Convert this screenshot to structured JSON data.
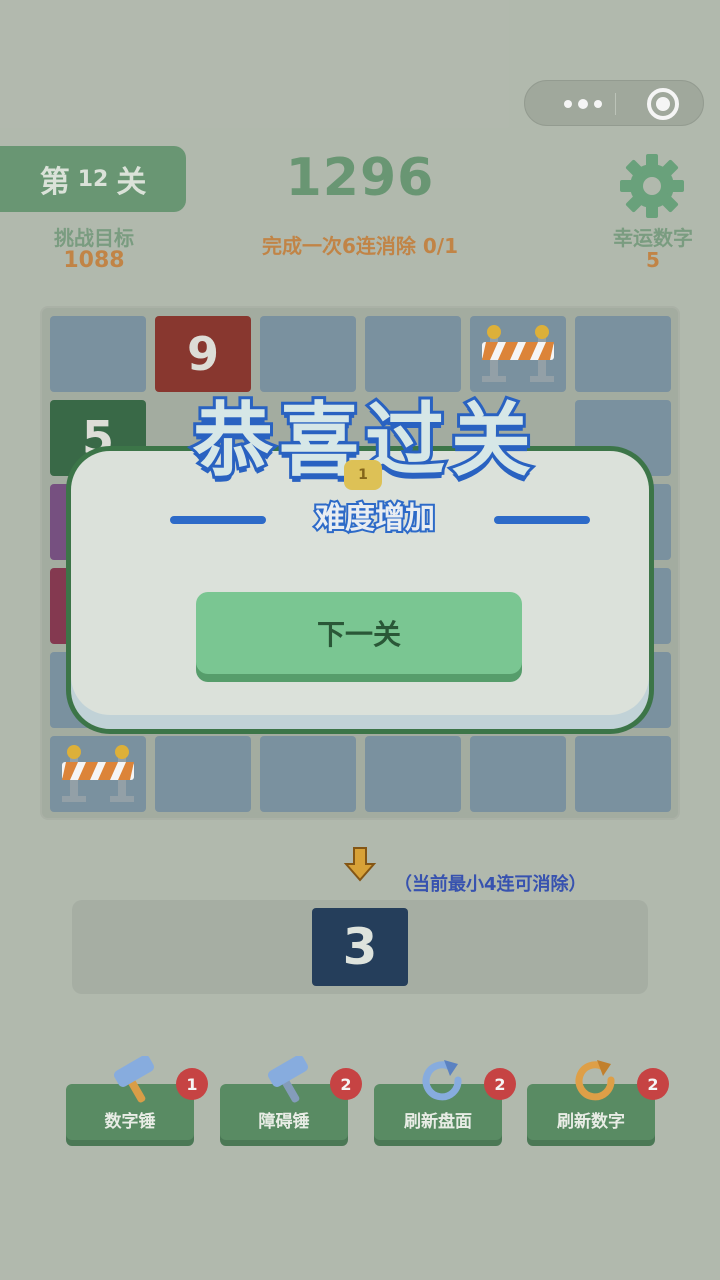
{
  "header": {
    "level_prefix": "第",
    "level_number": "12",
    "level_suffix": "关",
    "score": "1296",
    "task": "完成一次6连消除 0/1",
    "goal_label": "挑战目标",
    "goal_value": "1088",
    "lucky_label": "幸运数字",
    "lucky_value": "5"
  },
  "board": {
    "visible_numbers": [
      "9",
      "5"
    ]
  },
  "popup": {
    "title": "恭喜过关",
    "badge": "1",
    "subtitle": "难度增加",
    "next_button": "下一关"
  },
  "hint": "（当前最小4连可消除）",
  "next_tile": "3",
  "tools": [
    {
      "label": "数字锤",
      "count": "1",
      "icon": "hammer-icon"
    },
    {
      "label": "障碍锤",
      "count": "2",
      "icon": "hammer-icon"
    },
    {
      "label": "刷新盘面",
      "count": "2",
      "icon": "refresh-icon"
    },
    {
      "label": "刷新数字",
      "count": "2",
      "icon": "refresh-icon"
    }
  ],
  "colors": {
    "accent_green": "#6e9d78",
    "orange_text": "#c98a49",
    "popup_border": "#3f7a4b",
    "title_blue": "#2b66c9"
  }
}
